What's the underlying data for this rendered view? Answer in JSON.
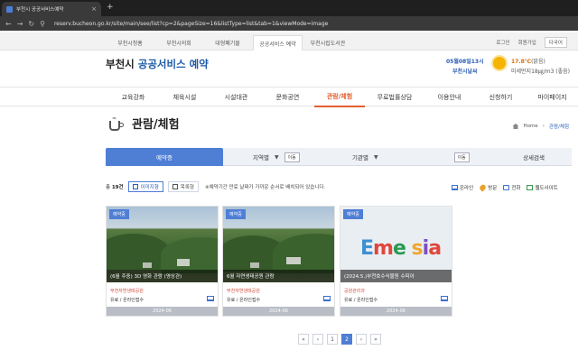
{
  "browser": {
    "tab_title": "부천시 공공서비스예약",
    "tab_close": "×",
    "new_tab": "+",
    "url": "reserv.bucheon.go.kr/site/main/see/list?cp=2&pageSize=16&listType=list&tab=1&viewMode=image"
  },
  "site_nav": {
    "items": [
      "부천시청홈",
      "부천시의회",
      "대형폐기물",
      "공공서비스 예약",
      "부천시립도서관"
    ],
    "login": "로그인",
    "signup": "회원가입",
    "language": "다국어"
  },
  "header": {
    "logo_prefix": "부천시 ",
    "logo_accent": "공공서비스 예약",
    "weather_date": "05월08일13시",
    "weather_place": "부천시날씨",
    "temperature": "17.8℃",
    "condition": "(맑음)",
    "dust": "미세먼지18㎍/m3 (좋음)"
  },
  "main_menu": [
    "교육강좌",
    "체육시설",
    "시설대관",
    "문화공연",
    "관람/체험",
    "무료법률상담",
    "이용안내",
    "신청하기",
    "마이페이지"
  ],
  "page": {
    "title": "관람/체험",
    "breadcrumb_home": "Home",
    "breadcrumb_current": "관람/체험"
  },
  "filter": {
    "booked_tab": "예약중",
    "region_label": "지역별",
    "region_button": "이동",
    "org_label": "기관별",
    "org_button": "이동",
    "advanced": "상세검색"
  },
  "toolbar": {
    "count_prefix": "총",
    "count_value": "19건",
    "image_view": "이미지형",
    "list_view": "목록형",
    "note": "※예약기간 만료 날짜가 가까운 순서로 배치되어 있습니다."
  },
  "legend": [
    "온라인",
    "방문",
    "전화",
    "웹도사이트"
  ],
  "legend_colors": [
    "#3b6fd0",
    "#e9a12a",
    "#3b6fd0",
    "#3a9a4a"
  ],
  "cards": [
    {
      "badge": "예약중",
      "caption": "(6월 주중) 3D 영화 관람 (영상관)",
      "place": "부천자연생태공원",
      "fee": "유료 / 온라인접수",
      "date": "2024-06"
    },
    {
      "badge": "예약중",
      "caption": "6월 자연생태공원 관람",
      "place": "부천자연생태공원",
      "fee": "유료 / 온라인접수",
      "date": "2024-06"
    },
    {
      "badge": "예약중",
      "caption": "(2024.5.)부천호수식물원 수피아",
      "place": "공원관리과",
      "fee": "유료 / 온라인접수",
      "date": "2024-06",
      "image_text": "Eme sia"
    }
  ],
  "pager": [
    "«",
    "‹",
    "1",
    "2",
    "›",
    "»"
  ],
  "pager_active": "2"
}
